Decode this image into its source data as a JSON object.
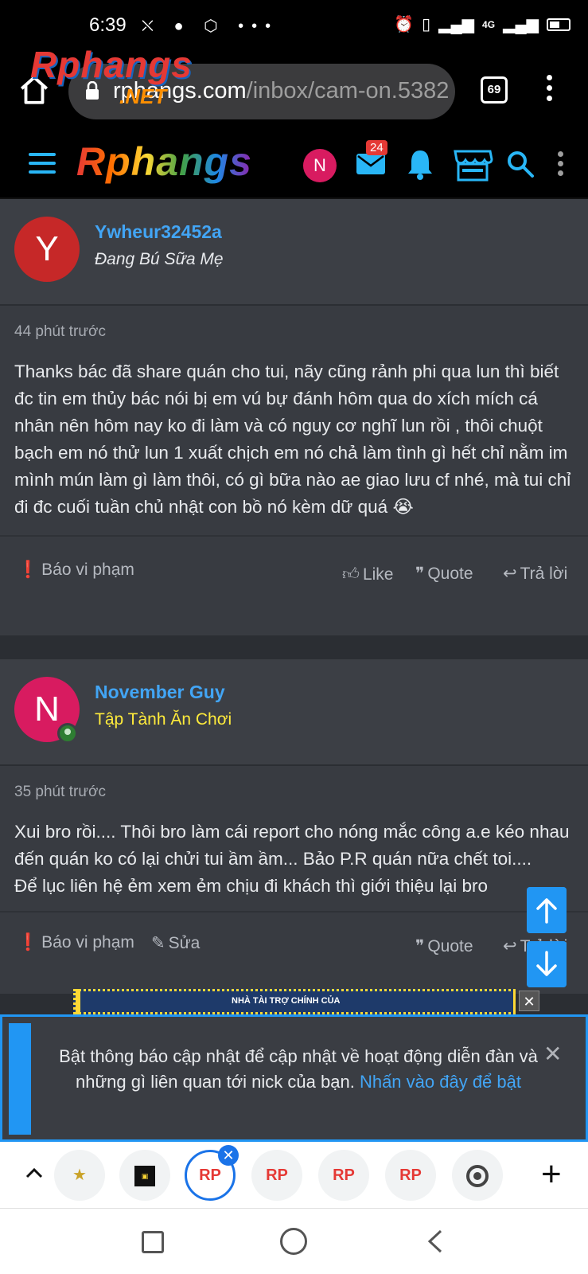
{
  "status_bar": {
    "time": "6:39",
    "net_type": "4G"
  },
  "browser": {
    "url_host": "rphangs.com",
    "url_path": "/inbox/cam-on.5382",
    "tab_count": "69",
    "watermark_brand": "Rphangs",
    "watermark_suffix": ".NET"
  },
  "site_header": {
    "logo": "Rphangs",
    "avatar_letter": "N",
    "inbox_badge": "24"
  },
  "posts": [
    {
      "avatar_letter": "Y",
      "avatar_color": "#c62828",
      "username": "Ywheur32452a",
      "user_title": "Đang Bú Sữa Mẹ",
      "user_title_color": "#e8eaed",
      "time": "44 phút trước",
      "body": "Thanks bác đã share quán cho tui, nãy cũng rảnh phi qua lun thì biết đc tin em thủy bác nói bị em vú bự đánh hôm qua do xích mích cá nhân nên hôm nay ko đi làm và có nguy cơ nghĩ lun rồi , thôi chuột bạch em nó thử lun 1 xuất chịch em nó chả làm tình gì hết chỉ nằm im mình mún làm gì làm thôi, có gì bữa nào ae giao lưu cf nhé, mà tui chỉ đi đc cuối tuần chủ nhật con bồ nó kèm dữ quá 😭",
      "actions": {
        "report": "Báo vi phạm",
        "like": "Like",
        "quote": "Quote",
        "reply": "Trả lời"
      }
    },
    {
      "avatar_letter": "N",
      "avatar_color": "#d81b60",
      "username": "November Guy",
      "user_title": "Tập Tành Ăn Chơi",
      "user_title_color": "#ffeb3b",
      "time": "35 phút trước",
      "body_lines": [
        "Xui bro rồi.... Thôi bro làm cái report cho nóng mắc công a.e kéo nhau đến quán ko có lại chửi tui ầm ầm... Bảo P.R quán nữa chết toi....",
        "Để lục liên hệ ẻm xem ẻm chịu đi khách thì giới thiệu lại bro"
      ],
      "actions": {
        "report": "Báo vi phạm",
        "edit": "Sửa",
        "quote": "Quote",
        "reply": "Trả lời"
      }
    }
  ],
  "ad": {
    "text": "NHÀ TÀI TRỢ CHÍNH CỦA"
  },
  "notice": {
    "text": "Bật thông báo cập nhật để cập nhật về hoạt động diễn đàn và những gì liên quan tới nick của bạn.",
    "link": "Nhấn vào đây để bật"
  },
  "tab_strip": {
    "tabs": [
      {
        "label": ""
      },
      {
        "label": ""
      },
      {
        "label": "RP"
      },
      {
        "label": "RP"
      },
      {
        "label": "RP"
      },
      {
        "label": "RP"
      },
      {
        "label": ""
      }
    ]
  },
  "colors": {
    "accent": "#2196f3",
    "link": "#42a5f5",
    "badge": "#e53935"
  }
}
